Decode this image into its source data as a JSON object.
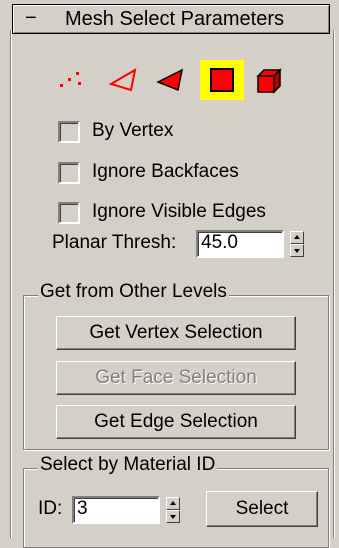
{
  "rollout": {
    "toggle": "−",
    "title": "Mesh Select Parameters"
  },
  "subobject_icons": [
    {
      "name": "vertex-icon",
      "selected": false
    },
    {
      "name": "edge-icon",
      "selected": false
    },
    {
      "name": "face-icon",
      "selected": false
    },
    {
      "name": "polygon-icon",
      "selected": true
    },
    {
      "name": "element-icon",
      "selected": false
    }
  ],
  "colors": {
    "accent": "#ff0000",
    "selected_bg": "#ffff00",
    "panel": "#d4d0c8"
  },
  "checkboxes": {
    "by_vertex": {
      "label": "By Vertex",
      "checked": false
    },
    "ignore_backfaces": {
      "label": "Ignore Backfaces",
      "checked": false
    },
    "ignore_visible_edges": {
      "label": "Ignore Visible Edges",
      "checked": false
    }
  },
  "planar_thresh": {
    "label": "Planar Thresh:",
    "value": "45.0"
  },
  "get_from_other_levels": {
    "title": "Get from Other Levels",
    "vertex_button": "Get Vertex Selection",
    "face_button": "Get Face Selection",
    "edge_button": "Get Edge Selection"
  },
  "select_by_material": {
    "title": "Select by Material ID",
    "id_label": "ID:",
    "id_value": "3",
    "select_button": "Select"
  }
}
